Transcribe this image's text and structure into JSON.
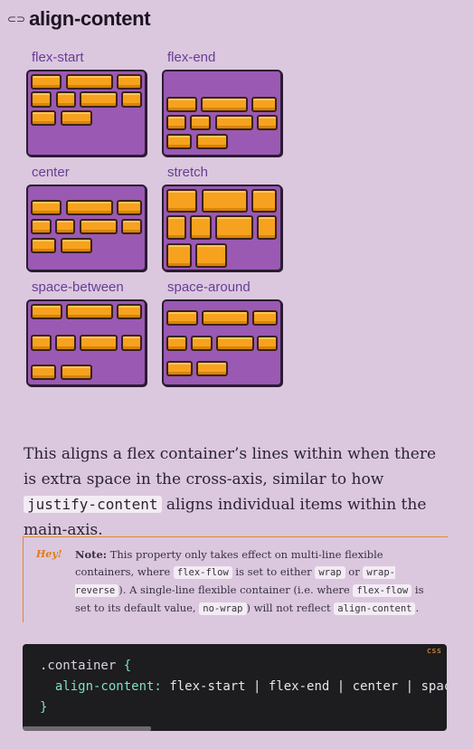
{
  "header": {
    "link_icon": "link-icon",
    "title": "align-content"
  },
  "demos": [
    {
      "label": "flex-start"
    },
    {
      "label": "flex-end"
    },
    {
      "label": "center"
    },
    {
      "label": "stretch"
    },
    {
      "label": "space-between"
    },
    {
      "label": "space-around"
    }
  ],
  "paragraph": {
    "part1": "This aligns a flex container’s lines within when there is extra space in the cross-axis, similar to how ",
    "code1": "justify-content",
    "part2": " aligns individual items within the main-axis."
  },
  "note": {
    "tag": "Hey!",
    "label": "Note:",
    "t1": " This property only takes effect on multi-line flexible containers, where ",
    "c1": "flex-flow",
    "t2": " is set to either ",
    "c2": "wrap",
    "t3": " or ",
    "c3": "wrap-reverse",
    "t4": "). A single-line flexible container (i.e. where ",
    "c4": "flex-flow",
    "t5": " is set to its default value, ",
    "c5": "no-wrap",
    "t6": ") will not reflect ",
    "c6": "align-content",
    "t7": "."
  },
  "code": {
    "lang": "css",
    "selector": ".container",
    "open": "{",
    "property": "align-content:",
    "value": "flex-start | flex-end | center | space-between | space-around",
    "close": "}"
  },
  "colors": {
    "box": "#9a59b3",
    "item": "#f7a21f",
    "label": "#6a3c94",
    "note_accent": "#e07d18",
    "code_bg": "#1d1c1f"
  }
}
